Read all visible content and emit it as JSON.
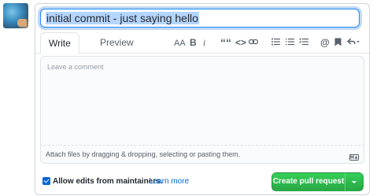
{
  "title_input": {
    "value": "initial commit - just saying hello"
  },
  "tabs": [
    {
      "label": "Write"
    },
    {
      "label": "Preview"
    }
  ],
  "toolbar": {
    "header_label": "AA",
    "bold_label": "B",
    "italic_label": "i",
    "quote_label": "““",
    "code_label": "<>",
    "icons": [
      "header-icon",
      "bold-icon",
      "italic-icon",
      "quote-icon",
      "code-icon",
      "link-icon",
      "unordered-list-icon",
      "ordered-list-icon",
      "task-list-icon",
      "mention-icon",
      "saved-reply-icon",
      "reply-arrow-icon"
    ]
  },
  "comment": {
    "placeholder": "Leave a comment",
    "attach_text": "Attach files by dragging & dropping, selecting or pasting them."
  },
  "footer": {
    "allow_edits_label": "Allow edits from maintainers.",
    "learn_more": "Learn more",
    "create_button": "Create pull request"
  },
  "colors": {
    "accent": "#0366d6",
    "create_green": "#2ea44f",
    "focus_ring": "#2188ff"
  }
}
